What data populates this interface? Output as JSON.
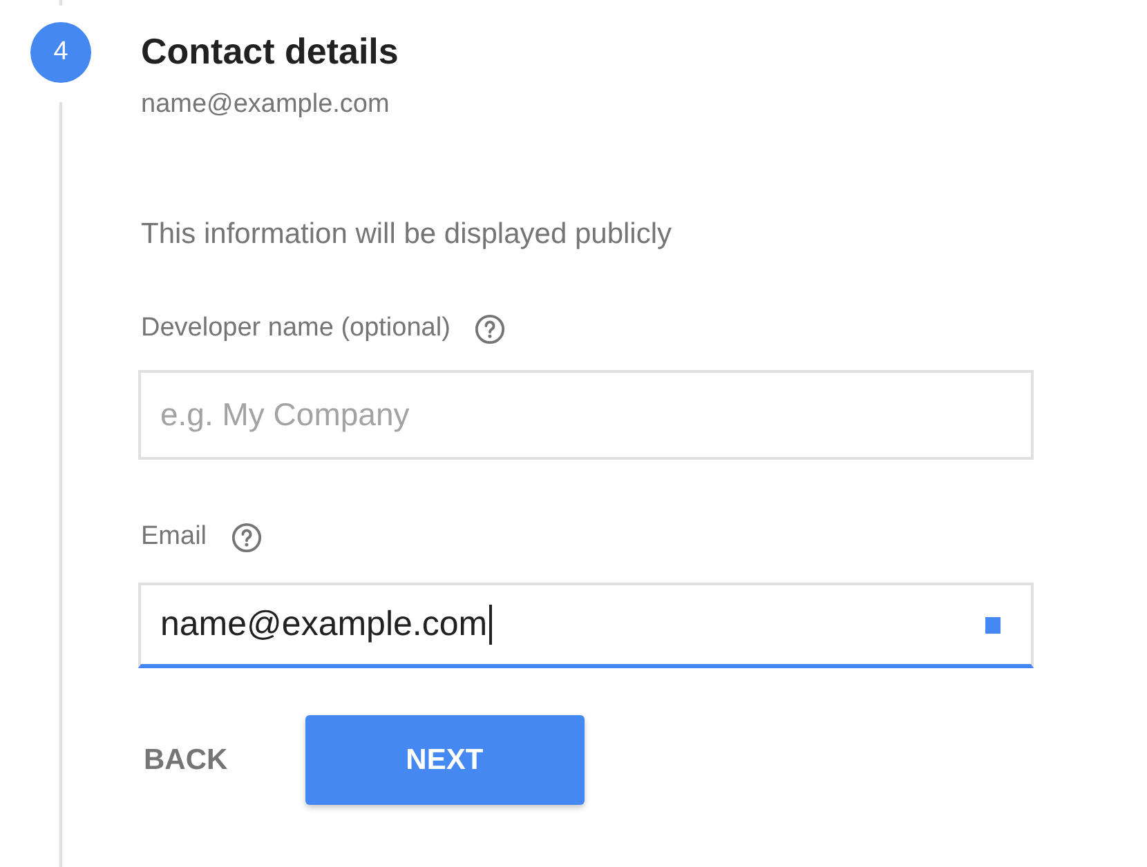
{
  "step": {
    "number": "4",
    "active": true,
    "title": "Contact details",
    "summary": "name@example.com"
  },
  "intro": "This information will be displayed publicly",
  "fields": [
    {
      "label": "Developer name (optional)",
      "help": true,
      "placeholder": "e.g. My Company",
      "focused": false
    },
    {
      "label": "Email",
      "help": true,
      "value": "name@example.com",
      "focused": true,
      "marker": true
    }
  ],
  "buttons": [
    {
      "label": "BACK",
      "kind": "flat"
    },
    {
      "label": "NEXT",
      "kind": "raised"
    }
  ]
}
